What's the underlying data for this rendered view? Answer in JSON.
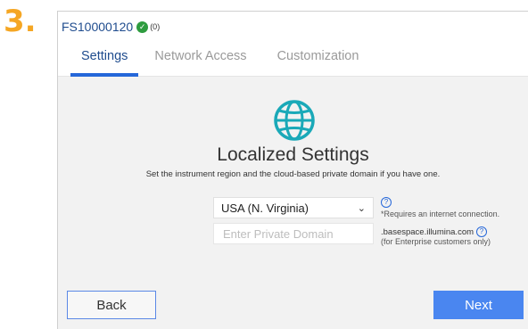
{
  "step": "3.",
  "header": {
    "device_id": "FS10000120",
    "status_icon": "check-circle-icon",
    "status_count": "(0)",
    "status_color": "#2e9c3f"
  },
  "tabs": [
    {
      "label": "Settings",
      "active": true
    },
    {
      "label": "Network Access",
      "active": false
    },
    {
      "label": "Customization",
      "active": false
    }
  ],
  "main": {
    "icon": "globe-icon",
    "title": "Localized Settings",
    "description": "Set the instrument region and the cloud-based private domain if you have one.",
    "region": {
      "selected": "USA (N. Virginia)",
      "note": "*Requires an internet connection."
    },
    "domain": {
      "placeholder": "Enter Private Domain",
      "value": "",
      "suffix": ".basespace.illumina.com",
      "note": "(for Enterprise customers only)"
    }
  },
  "footer": {
    "back_label": "Back",
    "next_label": "Next"
  },
  "colors": {
    "accent": "#2567d9",
    "step_number": "#f5a623",
    "next_button": "#4a86f0",
    "globe": "#1aa9b8"
  }
}
